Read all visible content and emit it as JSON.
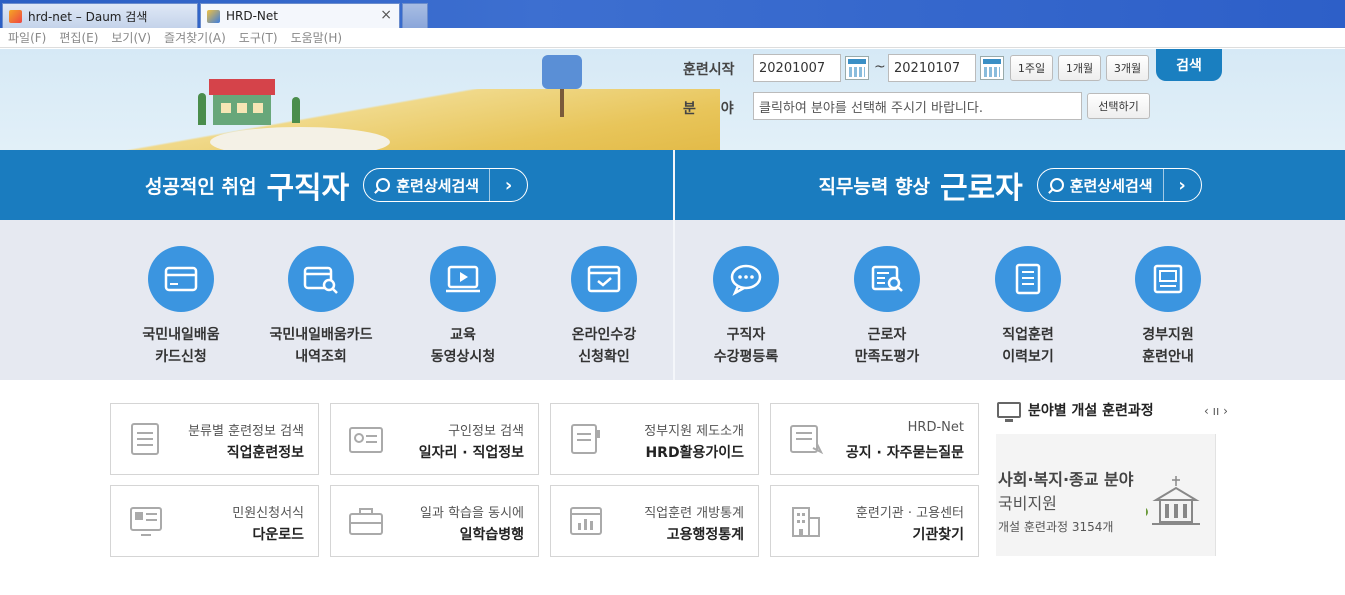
{
  "browser": {
    "tabs": [
      {
        "label": "hrd-net – Daum 검색",
        "active": false
      },
      {
        "label": "HRD-Net",
        "active": true
      }
    ],
    "menu": [
      "파일(F)",
      "편집(E)",
      "보기(V)",
      "즐겨찾기(A)",
      "도구(T)",
      "도움말(H)"
    ]
  },
  "search": {
    "start_label": "훈련시작",
    "start_date": "20201007",
    "tilde": "~",
    "end_date": "20210107",
    "range_buttons": [
      "1주일",
      "1개월",
      "3개월"
    ],
    "search_button": "검색",
    "field_label": "분 야",
    "field_placeholder": "클릭하여 분야를 선택해 주시기 바랍니다.",
    "select_button": "선택하기"
  },
  "banners": [
    {
      "sub": "성공적인 취업",
      "big": "구직자",
      "pill": "훈련상세검색",
      "arrow": "›"
    },
    {
      "sub": "직무능력 향상",
      "big": "근로자",
      "pill": "훈련상세검색",
      "arrow": "›"
    }
  ],
  "services": [
    {
      "line1": "국민내일배움",
      "line2": "카드신청",
      "icon": "card-icon"
    },
    {
      "line1": "국민내일배움카드",
      "line2": "내역조회",
      "icon": "card-search-icon"
    },
    {
      "line1": "교육",
      "line2": "동영상시청",
      "icon": "video-icon"
    },
    {
      "line1": "온라인수강",
      "line2": "신청확인",
      "icon": "online-check-icon"
    },
    {
      "line1": "구직자",
      "line2": "수강평등록",
      "icon": "chat-icon"
    },
    {
      "line1": "근로자",
      "line2": "만족도평가",
      "icon": "survey-icon"
    },
    {
      "line1": "직업훈련",
      "line2": "이력보기",
      "icon": "history-icon"
    },
    {
      "line1": "경부지원",
      "line2": "훈련안내",
      "icon": "guide-book-icon"
    }
  ],
  "cards": [
    {
      "t1": "분류별 훈련정보 검색",
      "t2": "직업훈련정보",
      "icon": "document-list-icon"
    },
    {
      "t1": "구인정보 검색",
      "t2": "일자리 · 직업정보",
      "icon": "id-card-icon"
    },
    {
      "t1": "정부지원 제도소개",
      "t2": "HRD활용가이드",
      "icon": "guide-icon"
    },
    {
      "t1": "HRD-Net",
      "t2": "공지 · 자주묻는질문",
      "icon": "notice-icon"
    },
    {
      "t1": "민원신청서식",
      "t2": "다운로드",
      "icon": "form-download-icon"
    },
    {
      "t1": "일과 학습을 동시에",
      "t2": "일학습병행",
      "icon": "briefcase-icon"
    },
    {
      "t1": "직업훈련 개방통계",
      "t2": "고용행정통계",
      "icon": "statistics-icon"
    },
    {
      "t1": "훈련기관 · 고용센터",
      "t2": "기관찾기",
      "icon": "building-icon"
    }
  ],
  "panel": {
    "title": "분야별 개설 훈련과정",
    "pager": "‹ ıı ›",
    "promo_line1": "사회·복지·종교 분야",
    "promo_line2": "국비지원",
    "promo_line3": "개설 훈련과정 3154개"
  }
}
